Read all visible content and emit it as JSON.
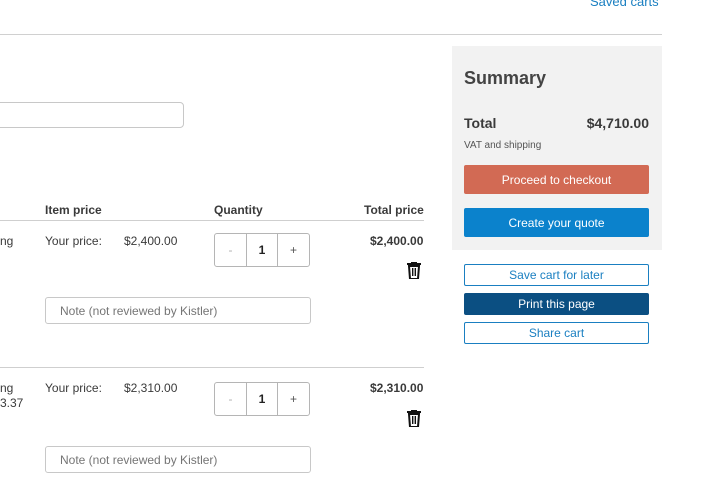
{
  "header": {
    "saved_carts_link": "Saved carts"
  },
  "table": {
    "headers": {
      "item_price": "Item price",
      "quantity": "Quantity",
      "total_price": "Total price"
    },
    "rows": [
      {
        "name_fragment_1": "ng",
        "name_fragment_2": "",
        "price_label": "Your price:",
        "price": "$2,400.00",
        "quantity": "1",
        "minus": "-",
        "plus": "+",
        "total": "$2,400.00",
        "note_placeholder": "Note (not reviewed by Kistler)"
      },
      {
        "name_fragment_1": "ng",
        "name_fragment_2": "3.37",
        "price_label": "Your price:",
        "price": "$2,310.00",
        "quantity": "1",
        "minus": "-",
        "plus": "+",
        "total": "$2,310.00",
        "note_placeholder": "Note (not reviewed by Kistler)"
      }
    ]
  },
  "summary": {
    "title": "Summary",
    "total_label": "Total",
    "total_amount": "$4,710.00",
    "vat_note": "VAT and shipping",
    "checkout_button": "Proceed to checkout",
    "quote_button": "Create your quote"
  },
  "actions": {
    "save_cart": "Save cart for later",
    "print_page": "Print this page",
    "share_cart": "Share cart"
  },
  "icons": [
    "trash-icon"
  ],
  "colors": {
    "accent_blue": "#1a7fc1",
    "quote_blue": "#0b82cc",
    "checkout_orange": "#d26a54",
    "print_navy": "#0b4f82"
  }
}
